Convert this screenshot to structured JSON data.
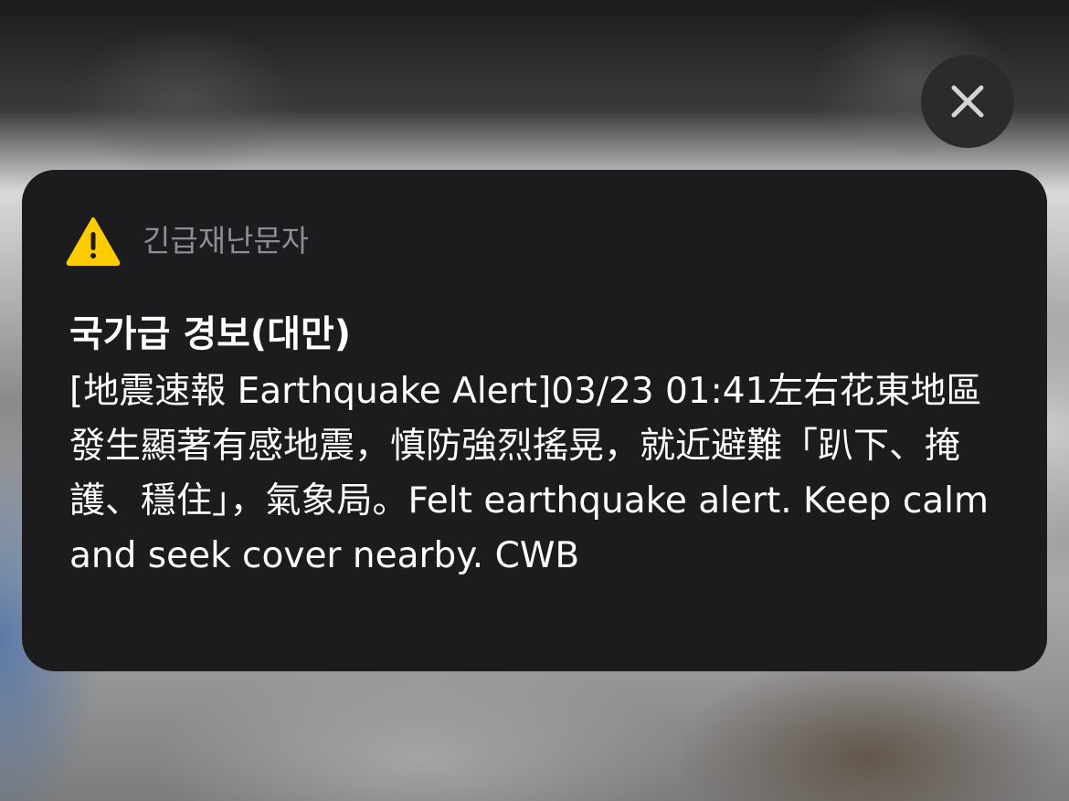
{
  "close_button": {
    "icon": "close-icon",
    "aria_label": "Close"
  },
  "notification": {
    "app_name": "긴급재난문자",
    "icon": "warning-triangle-icon",
    "icon_color": "#FFCC00",
    "title": "국가급 경보(대만)",
    "body": "[地震速報 Earthquake Alert]03/23 01:41左右花東地區發生顯著有感地震，慎防強烈搖晃，就近避難「趴下、掩護、穩住」，氣象局。Felt earthquake alert. Keep calm and seek cover nearby. CWB"
  }
}
